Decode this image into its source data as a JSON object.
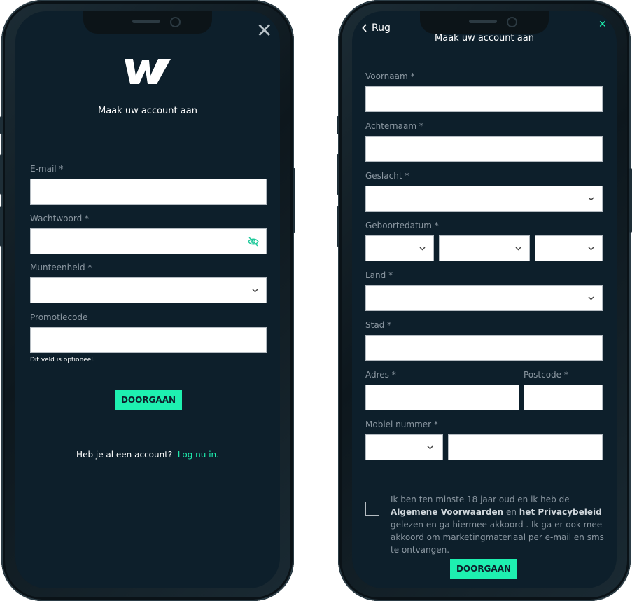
{
  "left": {
    "title": "Maak uw account aan",
    "fields": [
      {
        "label": "E-mail *"
      },
      {
        "label": "Wachtwoord *"
      },
      {
        "label": "Munteenheid *"
      },
      {
        "label": "Promotiecode"
      }
    ],
    "promo_help": "Dit veld is optioneel.",
    "continue_label": "DOORGAAN",
    "have_account": "Heb je al een account?",
    "login_link": "Log nu in."
  },
  "right": {
    "back_label": "Rug",
    "title": "Maak uw account aan",
    "labels": {
      "first_name": "Voornaam *",
      "last_name": "Achternaam *",
      "gender": "Geslacht *",
      "birthdate": "Geboortedatum *",
      "country": "Land *",
      "city": "Stad *",
      "address": "Adres *",
      "postcode": "Postcode *",
      "mobile": "Mobiel nummer *"
    },
    "terms": {
      "t1": "Ik ben ten minste 18 jaar oud en ik heb de ",
      "l1": "Algemene Voorwaarden",
      "t2": " en ",
      "l2": "het Privacybeleid",
      "t3": " gelezen en ga hiermee akkoord . Ik ga er ook mee akkoord om marketingmateriaal per e-mail en sms te ontvangen."
    },
    "continue_label": "DOORGAAN"
  },
  "colors": {
    "accent": "#1ef0b0",
    "screen": "#0d1f2b"
  }
}
